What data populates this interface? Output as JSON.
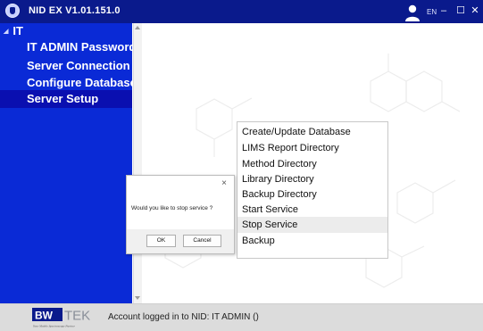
{
  "window": {
    "title": "NID EX V1.01.151.0",
    "language": "EN",
    "minimize_glyph": "–",
    "maximize_glyph": "☐",
    "close_glyph": "✕"
  },
  "sidebar": {
    "root": "IT",
    "root_caret": "◢",
    "items": [
      {
        "label": "IT ADMIN Password"
      },
      {
        "label": "Server Connection"
      },
      {
        "label": "Configure Database"
      },
      {
        "label": "Server Setup",
        "selected": true
      }
    ]
  },
  "menu": {
    "items": [
      {
        "label": "Create/Update Database"
      },
      {
        "label": "LIMS Report Directory"
      },
      {
        "label": "Method Directory"
      },
      {
        "label": "Library Directory"
      },
      {
        "label": "Backup Directory"
      },
      {
        "label": "Start Service"
      },
      {
        "label": "Stop Service",
        "hovered": true
      },
      {
        "label": "Backup"
      }
    ]
  },
  "dialog": {
    "message": "Would you like to stop service ?",
    "ok_label": "OK",
    "cancel_label": "Cancel",
    "close_glyph": "×"
  },
  "status": {
    "text": "Account logged in to NID: IT ADMIN ()"
  },
  "logo": {
    "brand": "B&WTEK",
    "tagline": "Your Mobile Spectroscopy Partner"
  },
  "colors": {
    "titlebar": "#0a1a8c",
    "sidebar": "#0a2ad6",
    "sidebar_selected": "#0a0fb0",
    "statusbar": "#dcdcdc"
  },
  "icons": {
    "app": "app-shield-icon",
    "user": "user-icon",
    "root_caret": "caret-expanded-icon"
  }
}
